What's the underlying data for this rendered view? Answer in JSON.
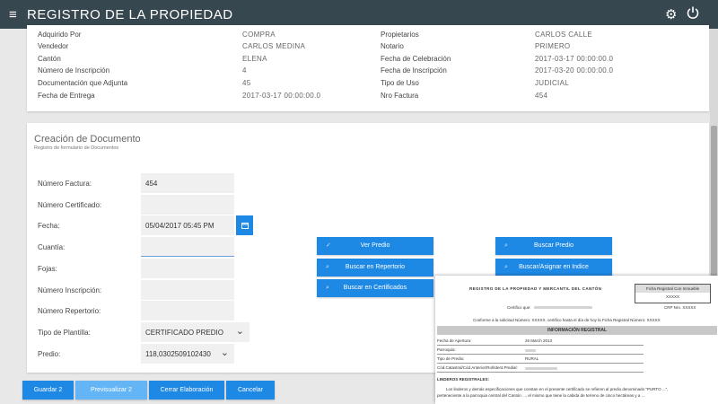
{
  "app": {
    "title": "REGISTRO DE LA PROPIEDAD",
    "menu_icon": "≡",
    "settings_icon": "gear-icon",
    "power_icon": "power-icon"
  },
  "summary": {
    "left": [
      {
        "label": "Adquirido Por",
        "value": "COMPRA"
      },
      {
        "label": "Vendedor",
        "value": "CARLOS MEDINA"
      },
      {
        "label": "Cantón",
        "value": "ELENA"
      },
      {
        "label": "Número de Inscripción",
        "value": "4"
      },
      {
        "label": "Documentación que Adjunta",
        "value": "45"
      },
      {
        "label": "Fecha de Entrega",
        "value": "2017-03-17 00:00:00.0"
      }
    ],
    "right": [
      {
        "label": "Propietarios",
        "value": "CARLOS CALLE"
      },
      {
        "label": "Notario",
        "value": "PRIMERO"
      },
      {
        "label": "Fecha de Celebración",
        "value": "2017-03-17 00:00:00.0"
      },
      {
        "label": "Fecha de Inscripción",
        "value": "2017-03-20 00:00:00.0"
      },
      {
        "label": "Tipo de Uso",
        "value": "JUDICIAL"
      },
      {
        "label": "Nro Factura",
        "value": "454"
      }
    ]
  },
  "form": {
    "heading": "Creación de Documento",
    "subheading": "Registro de formulario de Documentos",
    "fields": [
      {
        "label": "Número Factura:",
        "value": "454"
      },
      {
        "label": "Número Certificado:",
        "value": ""
      },
      {
        "label": "Fecha:",
        "value": "05/04/2017 05:45 PM"
      },
      {
        "label": "Cuantía:",
        "value": ""
      },
      {
        "label": "Fojas:",
        "value": ""
      },
      {
        "label": "Número Inscripción:",
        "value": ""
      },
      {
        "label": "Número Repertorio:",
        "value": ""
      },
      {
        "label": "Tipo de Plantilla:",
        "value": "CERTIFICADO PREDIO"
      },
      {
        "label": "Predio:",
        "value": "118,0302509102430"
      }
    ],
    "calendar_icon": "calendar-icon"
  },
  "action_buttons": {
    "ver_predio": "Ver Predio",
    "buscar_repertorio": "Buscar en Repertorio",
    "buscar_certificados": "Buscar en Certificados",
    "buscar_predio": "Buscar Predio",
    "buscar_indice": "Buscar/Asignar en Indice"
  },
  "footer_buttons": {
    "guardar": "Guardar 2",
    "previsualizar": "Previsualizar 2",
    "cerrar": "Cerrar Elaboración",
    "cancelar": "Cancelar"
  },
  "preview": {
    "heading": "REGISTRO DE LA PROPIEDAD Y MERCANTIL DEL CANTÓN",
    "box_title": "Ficha Registral Con Inmueble",
    "box_value": "XXXXX",
    "crp": "CRP Nro. XXXXX",
    "line1": "Certifico que:",
    "line2": "Conforme a la solicitud Número: XXXXX, certifico hasta el día de hoy la Ficha Registral Número: XXXXX",
    "band": "INFORMACIÓN REGISTRAL",
    "rows": [
      {
        "label": "Fecha de Apertura:",
        "value": "26 March 2013"
      },
      {
        "label": "Parroquia:",
        "value": ""
      },
      {
        "label": "Tipo de Predio:",
        "value": "RURAL"
      },
      {
        "label": "Cód.Catastral/Cód.Anterior/Rol/Ident.Predial:",
        "value": ""
      }
    ],
    "linderos": "LINDEROS REGISTRALES:",
    "para1": "Los linderos y demás especificaciones que constan en el presente certificado se refieren al predio denominado \"PURTO ...\",",
    "para2": "perteneciente a la parroquia central del Cantón ..., el mismo que tiene la cabida de terreno de cinco hectáreas y a ..."
  }
}
